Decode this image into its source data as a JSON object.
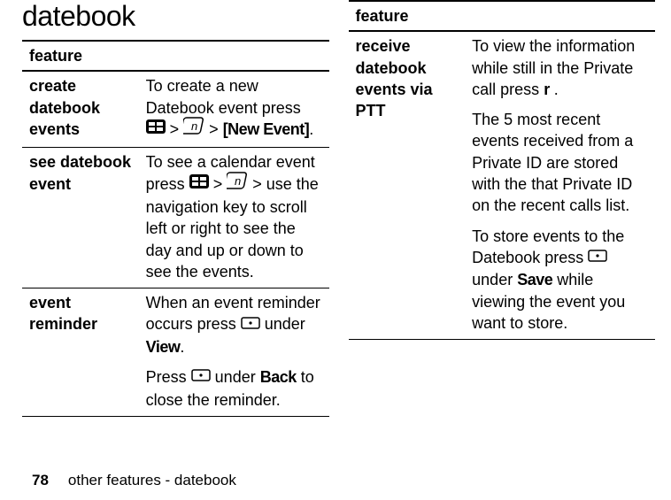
{
  "heading": "datebook",
  "footer": {
    "page": "78",
    "text": "other features - datebook"
  },
  "table_header": "feature",
  "left": {
    "rows": [
      {
        "name": "create datebook events",
        "p1_a": "To create a new Datebook event press ",
        "p1_b": " > ",
        "p1_c": " > ",
        "p1_d": "[New Event]",
        "p1_e": "."
      },
      {
        "name": "see datebook event",
        "p1_a": "To see a calendar event press ",
        "p1_b": " > ",
        "p1_c": " >  use the navigation key to scroll left or right to see the day and up or down to see the events."
      },
      {
        "name": "event reminder",
        "p1_a": "When an event reminder occurs press ",
        "p1_b": " under ",
        "p1_c": "View",
        "p1_d": ".",
        "p2_a": "Press ",
        "p2_b": " under ",
        "p2_c": "Back",
        "p2_d": " to close the reminder."
      }
    ]
  },
  "right": {
    "rows": [
      {
        "name": "receive datebook events via PTT",
        "p1_a": "To view the information while still in the Private call press ",
        "p1_b": "r",
        "p1_c": " .",
        "p2": "The 5 most recent events received from a Private ID are stored with the that Private ID on the recent calls list.",
        "p3_a": "To store events to the Datebook press ",
        "p3_b": " under ",
        "p3_c": "Save",
        "p3_d": " while viewing the event you want to store."
      }
    ]
  }
}
